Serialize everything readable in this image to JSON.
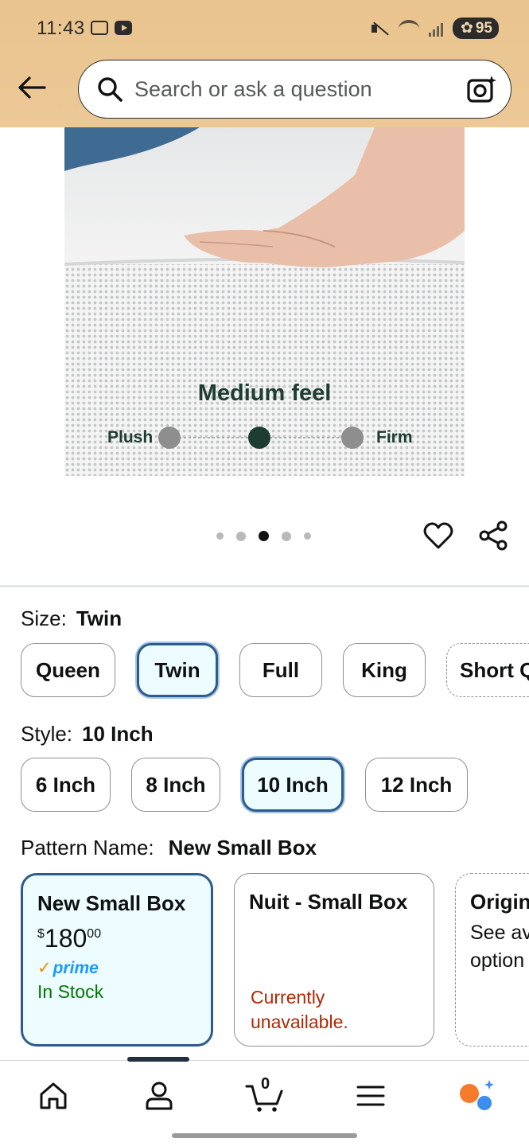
{
  "status_bar": {
    "time": "11:43",
    "battery": "95"
  },
  "header": {
    "back_label": "Back",
    "search_placeholder": "Search or ask a question"
  },
  "product_image": {
    "feel_title": "Medium feel",
    "left_label": "Plush",
    "right_label": "Firm",
    "carousel_total": 5,
    "carousel_active": 3
  },
  "size": {
    "label": "Size:",
    "selected": "Twin",
    "options": [
      "Queen",
      "Twin",
      "Full",
      "King",
      "Short Q"
    ]
  },
  "style": {
    "label": "Style:",
    "selected": "10 Inch",
    "options": [
      "6 Inch",
      "8 Inch",
      "10 Inch",
      "12 Inch"
    ]
  },
  "pattern": {
    "label": "Pattern Name:",
    "selected": "New Small Box",
    "cards": [
      {
        "title": "New Small Box",
        "price_symbol": "$",
        "price_whole": "180",
        "price_cents": "00",
        "prime": "prime",
        "stock": "In Stock"
      },
      {
        "title": "Nuit - Small Box",
        "status": "Currently unavailable."
      },
      {
        "title": "Origin",
        "note": "See av option"
      }
    ]
  },
  "bottom_nav": {
    "cart_count": "0"
  },
  "colors": {
    "header_bg": "#e9c48e",
    "selected_border": "#2d5b8c",
    "selected_bg": "#edfdff",
    "in_stock": "#007600",
    "unavailable": "#b12704",
    "prime": "#1a98ff"
  }
}
